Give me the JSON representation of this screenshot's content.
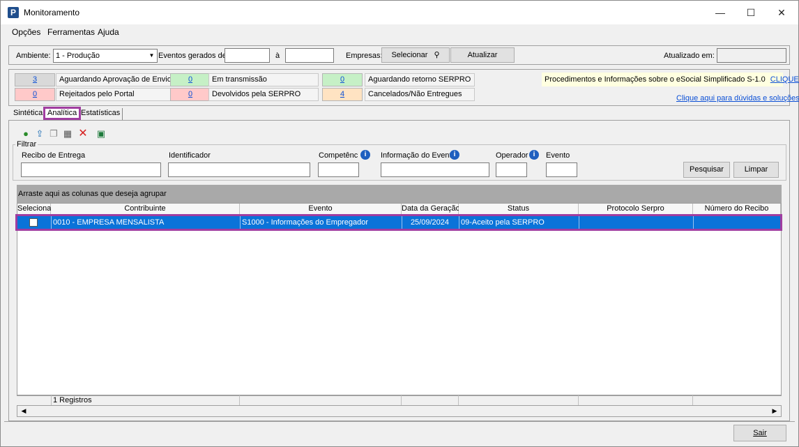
{
  "window": {
    "title": "Monitoramento",
    "app_icon": "P"
  },
  "menu": [
    "Opções",
    "Ferramentas",
    "Ajuda"
  ],
  "toolbar": {
    "ambiente_label": "Ambiente:",
    "ambiente_value": "1 - Produção",
    "eventos_label": "Eventos gerados de:",
    "eventos_from": "",
    "a_label": "à",
    "eventos_to": "",
    "empresas_label": "Empresas:",
    "selecionar_label": "Selecionar",
    "atualizar_label": "Atualizar",
    "atualizado_label": "Atualizado em:",
    "atualizado_value": ""
  },
  "status": [
    {
      "count": "3",
      "label": "Aguardando Aprovação de Envio",
      "color": "#d9d9d9"
    },
    {
      "count": "0",
      "label": "Em transmissão",
      "color": "#c6f0c6"
    },
    {
      "count": "0",
      "label": "Aguardando retorno SERPRO",
      "color": "#c6f0c6"
    },
    {
      "count": "0",
      "label": "Rejeitados pelo Portal",
      "color": "#ffc9c9"
    },
    {
      "count": "0",
      "label": "Devolvidos pela SERPRO",
      "color": "#ffc9c9"
    },
    {
      "count": "4",
      "label": "Cancelados/Não Entregues",
      "color": "#ffe3c2"
    }
  ],
  "info": {
    "text": "Procedimentos e Informações sobre o eSocial Simplificado S-1.0",
    "link": "CLIQUE AQUI",
    "help_link": "Clique aqui para dúvidas e soluções"
  },
  "tabs": [
    "Sintética",
    "Analítica",
    "Estatísticas"
  ],
  "active_tab": "Analítica",
  "filter": {
    "legend": "Filtrar",
    "recibo_label": "Recibo de Entrega",
    "identificador_label": "Identificador",
    "competencia_label": "Competênc",
    "informacao_label": "Informação do Evento",
    "operador_label": "Operador",
    "evento_label": "Evento",
    "pesquisar_label": "Pesquisar",
    "limpar_label": "Limpar"
  },
  "grid": {
    "group_hint": "Arraste aqui as colunas que deseja agrupar",
    "columns": [
      "Selecionar",
      "Contribuinte",
      "Evento",
      "Data da Geração",
      "Status",
      "Protocolo Serpro",
      "Número do Recibo"
    ],
    "rows": [
      {
        "selected": false,
        "contribuinte": "0010 - EMPRESA MENSALISTA",
        "evento": "S1000 - Informações do Empregador",
        "data": "25/09/2024",
        "status": "09-Aceito pela SERPRO",
        "protocolo": "",
        "recibo": ""
      }
    ],
    "footer_count": "1 Registros"
  },
  "footer": {
    "sair_label": "Sair"
  },
  "colors": {
    "selection": "#0a73d9",
    "highlight_border": "#a03da0",
    "group_bar": "#a9a9a9"
  }
}
